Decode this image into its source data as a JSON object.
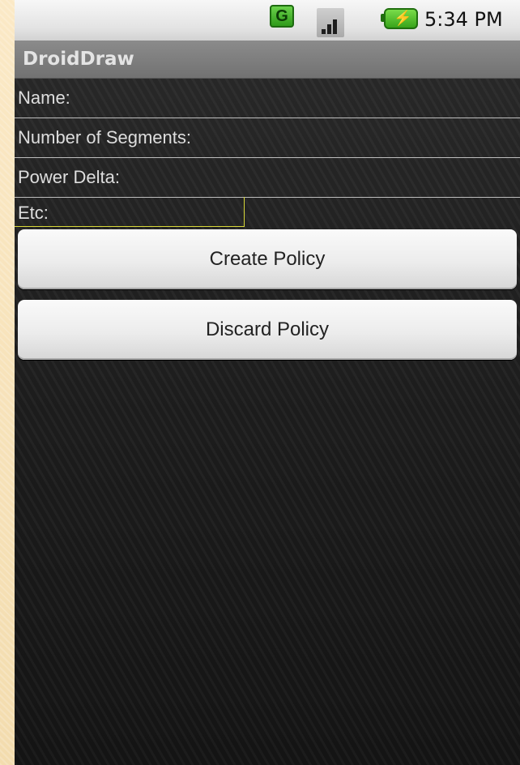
{
  "status_bar": {
    "network_badge": "G",
    "time": "5:34 PM",
    "icons": [
      "network-g-icon",
      "signal-bars-icon",
      "battery-charging-icon"
    ],
    "accent_green": "#3fae22"
  },
  "app": {
    "title": "DroidDraw"
  },
  "fields": [
    {
      "label": "Name:"
    },
    {
      "label": "Number of Segments:"
    },
    {
      "label": "Power Delta:"
    },
    {
      "label": "Etc:"
    }
  ],
  "buttons": {
    "create": "Create Policy",
    "discard": "Discard Policy"
  }
}
